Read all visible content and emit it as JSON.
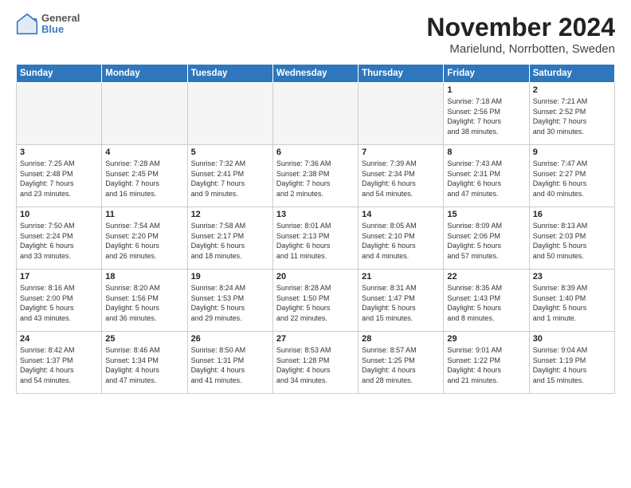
{
  "header": {
    "logo_line1": "General",
    "logo_line2": "Blue",
    "month_title": "November 2024",
    "location": "Marielund, Norrbotten, Sweden"
  },
  "days_of_week": [
    "Sunday",
    "Monday",
    "Tuesday",
    "Wednesday",
    "Thursday",
    "Friday",
    "Saturday"
  ],
  "weeks": [
    [
      {
        "num": "",
        "info": ""
      },
      {
        "num": "",
        "info": ""
      },
      {
        "num": "",
        "info": ""
      },
      {
        "num": "",
        "info": ""
      },
      {
        "num": "",
        "info": ""
      },
      {
        "num": "1",
        "info": "Sunrise: 7:18 AM\nSunset: 2:56 PM\nDaylight: 7 hours\nand 38 minutes."
      },
      {
        "num": "2",
        "info": "Sunrise: 7:21 AM\nSunset: 2:52 PM\nDaylight: 7 hours\nand 30 minutes."
      }
    ],
    [
      {
        "num": "3",
        "info": "Sunrise: 7:25 AM\nSunset: 2:48 PM\nDaylight: 7 hours\nand 23 minutes."
      },
      {
        "num": "4",
        "info": "Sunrise: 7:28 AM\nSunset: 2:45 PM\nDaylight: 7 hours\nand 16 minutes."
      },
      {
        "num": "5",
        "info": "Sunrise: 7:32 AM\nSunset: 2:41 PM\nDaylight: 7 hours\nand 9 minutes."
      },
      {
        "num": "6",
        "info": "Sunrise: 7:36 AM\nSunset: 2:38 PM\nDaylight: 7 hours\nand 2 minutes."
      },
      {
        "num": "7",
        "info": "Sunrise: 7:39 AM\nSunset: 2:34 PM\nDaylight: 6 hours\nand 54 minutes."
      },
      {
        "num": "8",
        "info": "Sunrise: 7:43 AM\nSunset: 2:31 PM\nDaylight: 6 hours\nand 47 minutes."
      },
      {
        "num": "9",
        "info": "Sunrise: 7:47 AM\nSunset: 2:27 PM\nDaylight: 6 hours\nand 40 minutes."
      }
    ],
    [
      {
        "num": "10",
        "info": "Sunrise: 7:50 AM\nSunset: 2:24 PM\nDaylight: 6 hours\nand 33 minutes."
      },
      {
        "num": "11",
        "info": "Sunrise: 7:54 AM\nSunset: 2:20 PM\nDaylight: 6 hours\nand 26 minutes."
      },
      {
        "num": "12",
        "info": "Sunrise: 7:58 AM\nSunset: 2:17 PM\nDaylight: 6 hours\nand 18 minutes."
      },
      {
        "num": "13",
        "info": "Sunrise: 8:01 AM\nSunset: 2:13 PM\nDaylight: 6 hours\nand 11 minutes."
      },
      {
        "num": "14",
        "info": "Sunrise: 8:05 AM\nSunset: 2:10 PM\nDaylight: 6 hours\nand 4 minutes."
      },
      {
        "num": "15",
        "info": "Sunrise: 8:09 AM\nSunset: 2:06 PM\nDaylight: 5 hours\nand 57 minutes."
      },
      {
        "num": "16",
        "info": "Sunrise: 8:13 AM\nSunset: 2:03 PM\nDaylight: 5 hours\nand 50 minutes."
      }
    ],
    [
      {
        "num": "17",
        "info": "Sunrise: 8:16 AM\nSunset: 2:00 PM\nDaylight: 5 hours\nand 43 minutes."
      },
      {
        "num": "18",
        "info": "Sunrise: 8:20 AM\nSunset: 1:56 PM\nDaylight: 5 hours\nand 36 minutes."
      },
      {
        "num": "19",
        "info": "Sunrise: 8:24 AM\nSunset: 1:53 PM\nDaylight: 5 hours\nand 29 minutes."
      },
      {
        "num": "20",
        "info": "Sunrise: 8:28 AM\nSunset: 1:50 PM\nDaylight: 5 hours\nand 22 minutes."
      },
      {
        "num": "21",
        "info": "Sunrise: 8:31 AM\nSunset: 1:47 PM\nDaylight: 5 hours\nand 15 minutes."
      },
      {
        "num": "22",
        "info": "Sunrise: 8:35 AM\nSunset: 1:43 PM\nDaylight: 5 hours\nand 8 minutes."
      },
      {
        "num": "23",
        "info": "Sunrise: 8:39 AM\nSunset: 1:40 PM\nDaylight: 5 hours\nand 1 minute."
      }
    ],
    [
      {
        "num": "24",
        "info": "Sunrise: 8:42 AM\nSunset: 1:37 PM\nDaylight: 4 hours\nand 54 minutes."
      },
      {
        "num": "25",
        "info": "Sunrise: 8:46 AM\nSunset: 1:34 PM\nDaylight: 4 hours\nand 47 minutes."
      },
      {
        "num": "26",
        "info": "Sunrise: 8:50 AM\nSunset: 1:31 PM\nDaylight: 4 hours\nand 41 minutes."
      },
      {
        "num": "27",
        "info": "Sunrise: 8:53 AM\nSunset: 1:28 PM\nDaylight: 4 hours\nand 34 minutes."
      },
      {
        "num": "28",
        "info": "Sunrise: 8:57 AM\nSunset: 1:25 PM\nDaylight: 4 hours\nand 28 minutes."
      },
      {
        "num": "29",
        "info": "Sunrise: 9:01 AM\nSunset: 1:22 PM\nDaylight: 4 hours\nand 21 minutes."
      },
      {
        "num": "30",
        "info": "Sunrise: 9:04 AM\nSunset: 1:19 PM\nDaylight: 4 hours\nand 15 minutes."
      }
    ]
  ]
}
